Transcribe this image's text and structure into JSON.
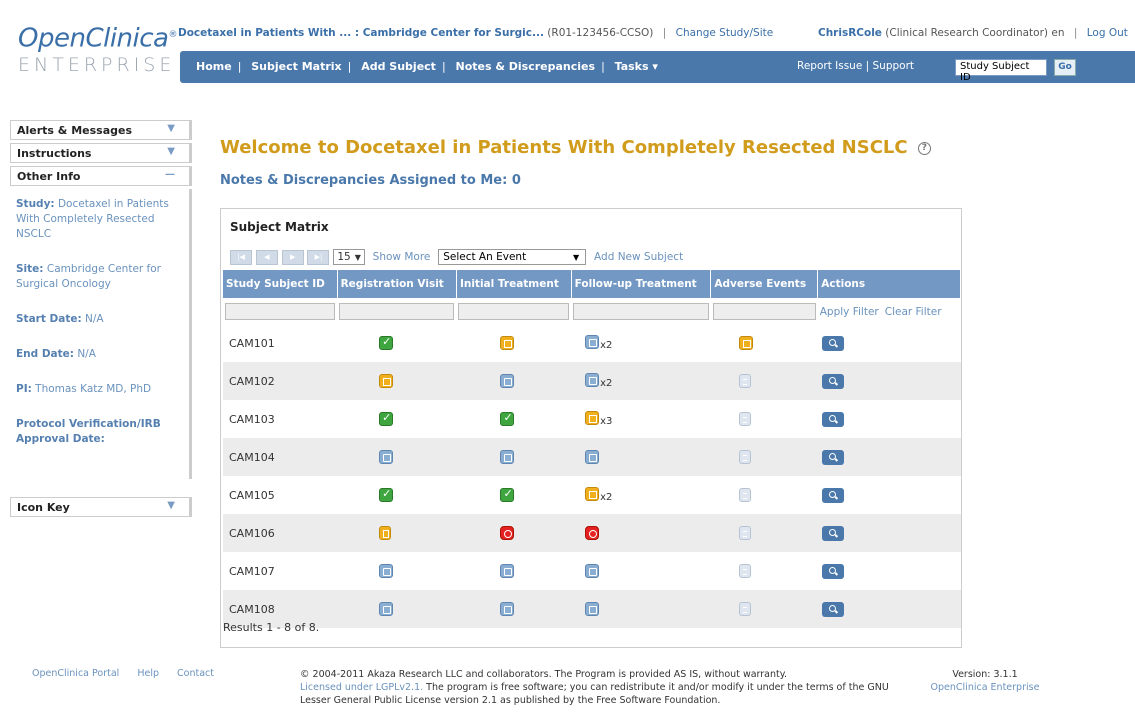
{
  "logo": {
    "line1": "OpenClinica",
    "line2": "ENTERPRISE"
  },
  "topbar": {
    "study": "Docetaxel in Patients With ... : Cambridge Center for Surgic...",
    "protocol": "(R01-123456-CCSO)",
    "change_link": "Change Study/Site",
    "user_name": "ChrisRCole",
    "user_role": "(Clinical Research Coordinator)",
    "lang": "en",
    "logout": "Log Out"
  },
  "nav": {
    "items": [
      "Home",
      "Subject Matrix",
      "Add Subject",
      "Notes & Discrepancies",
      "Tasks ▾"
    ],
    "report": "Report Issue",
    "support": "Support",
    "search_value": "Study Subject ID",
    "go": "Go"
  },
  "sidebar": {
    "tabs": {
      "alerts": "Alerts & Messages",
      "instructions": "Instructions",
      "other": "Other Info",
      "icon_key": "Icon Key"
    },
    "study_label": "Study:",
    "study_value": "Docetaxel in Patients With Completely Resected NSCLC",
    "site_label": "Site:",
    "site_value": "Cambridge Center for Surgical Oncology",
    "start_label": "Start Date:",
    "start_value": "N/A",
    "end_label": "End Date:",
    "end_value": "N/A",
    "pi_label": "PI:",
    "pi_value": "Thomas Katz MD, PhD",
    "protocol_label": "Protocol Verification/IRB Approval Date:"
  },
  "main": {
    "welcome": "Welcome to Docetaxel in Patients With Completely Resected NSCLC",
    "notes": "Notes & Discrepancies Assigned to Me: 0",
    "matrix_title": "Subject Matrix",
    "page_size": "15",
    "show_more": "Show More",
    "select_event": "Select An Event",
    "add_subject": "Add New Subject",
    "apply_filter": "Apply Filter",
    "clear_filter": "Clear Filter",
    "results": "Results 1 - 8 of 8.",
    "columns": [
      "Study Subject ID",
      "Registration Visit",
      "Initial Treatment",
      "Follow-up Treatment",
      "Adverse Events",
      "Actions"
    ],
    "rows": [
      {
        "id": "CAM101",
        "cells": [
          [
            "done",
            ""
          ],
          [
            "prog",
            ""
          ],
          [
            "sched",
            "x2"
          ],
          [
            "prog",
            ""
          ]
        ]
      },
      {
        "id": "CAM102",
        "cells": [
          [
            "prog",
            ""
          ],
          [
            "sched",
            ""
          ],
          [
            "sched",
            "x2"
          ],
          [
            "ns",
            ""
          ]
        ]
      },
      {
        "id": "CAM103",
        "cells": [
          [
            "done",
            ""
          ],
          [
            "done",
            ""
          ],
          [
            "prog",
            "x3"
          ],
          [
            "ns",
            ""
          ]
        ]
      },
      {
        "id": "CAM104",
        "cells": [
          [
            "sched",
            ""
          ],
          [
            "sched",
            ""
          ],
          [
            "sched",
            ""
          ],
          [
            "ns",
            ""
          ]
        ]
      },
      {
        "id": "CAM105",
        "cells": [
          [
            "done",
            ""
          ],
          [
            "done",
            ""
          ],
          [
            "prog",
            "x2"
          ],
          [
            "ns",
            ""
          ]
        ]
      },
      {
        "id": "CAM106",
        "cells": [
          [
            "locked",
            ""
          ],
          [
            "stop",
            ""
          ],
          [
            "stop",
            ""
          ],
          [
            "ns",
            ""
          ]
        ]
      },
      {
        "id": "CAM107",
        "cells": [
          [
            "sched",
            ""
          ],
          [
            "sched",
            ""
          ],
          [
            "sched",
            ""
          ],
          [
            "ns",
            ""
          ]
        ]
      },
      {
        "id": "CAM108",
        "cells": [
          [
            "sched",
            ""
          ],
          [
            "sched",
            ""
          ],
          [
            "sched",
            ""
          ],
          [
            "ns",
            ""
          ]
        ]
      }
    ]
  },
  "footer": {
    "portal": "OpenClinica Portal",
    "help": "Help",
    "contact": "Contact",
    "copy1": "© 2004-2011 Akaza Research LLC and collaborators. The Program is provided AS IS, without warranty.",
    "license": "Licensed under LGPLv2.1.",
    "copy2": "The program is free software; you can redistribute it and/or modify it under the terms of the GNU Lesser General Public License version 2.1 as published by the Free Software Foundation.",
    "version": "Version: 3.1.1",
    "edition": "OpenClinica Enterprise"
  }
}
